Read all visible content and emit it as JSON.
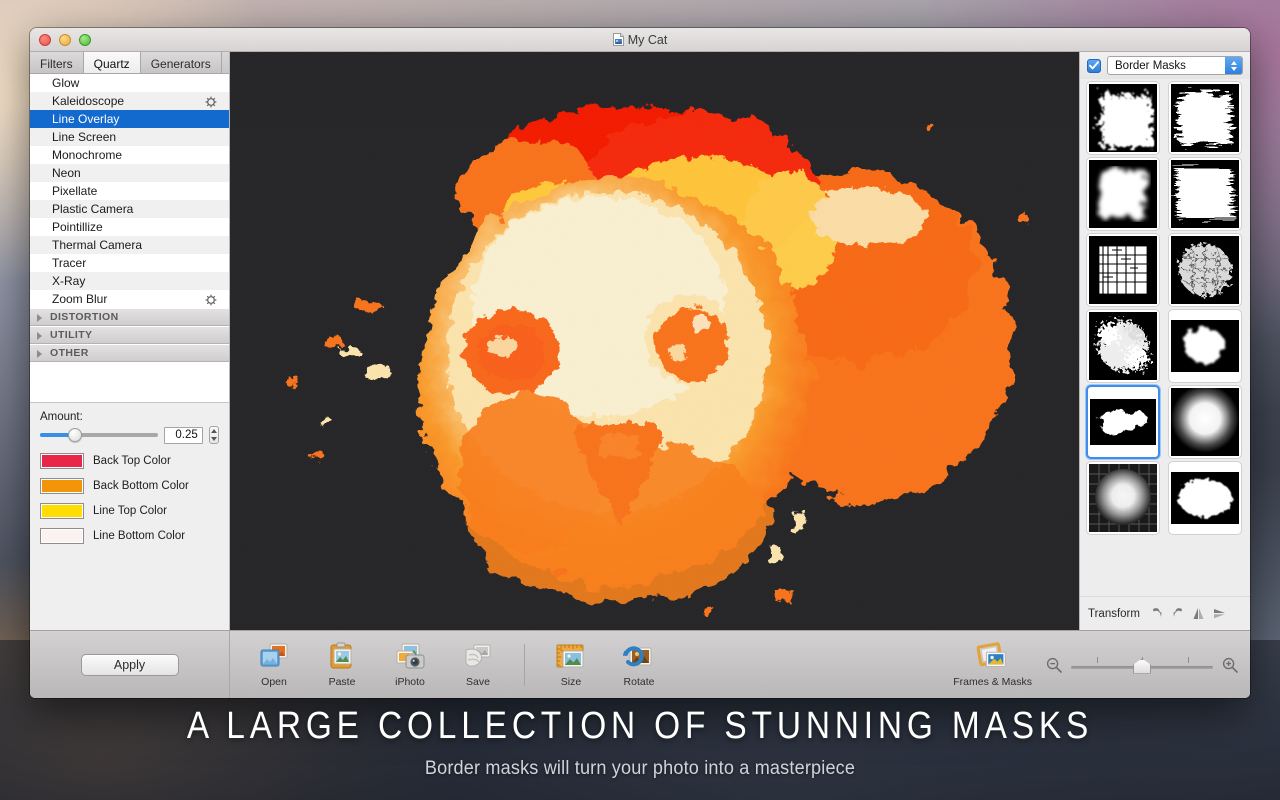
{
  "window": {
    "title": "My Cat",
    "doc_icon": "document-icon",
    "traffic_lights": [
      "close",
      "minimize",
      "zoom"
    ]
  },
  "sidebar": {
    "tabs": [
      {
        "label": "Filters",
        "active": false
      },
      {
        "label": "Quartz",
        "active": true
      },
      {
        "label": "Generators",
        "active": false
      }
    ],
    "filters": [
      {
        "label": "Glow",
        "selected": false,
        "gear": false
      },
      {
        "label": "Kaleidoscope",
        "selected": false,
        "gear": true
      },
      {
        "label": "Line Overlay",
        "selected": true,
        "gear": false
      },
      {
        "label": "Line Screen",
        "selected": false,
        "gear": false
      },
      {
        "label": "Monochrome",
        "selected": false,
        "gear": false
      },
      {
        "label": "Neon",
        "selected": false,
        "gear": false
      },
      {
        "label": "Pixellate",
        "selected": false,
        "gear": false
      },
      {
        "label": "Plastic Camera",
        "selected": false,
        "gear": false
      },
      {
        "label": "Pointillize",
        "selected": false,
        "gear": false
      },
      {
        "label": "Thermal Camera",
        "selected": false,
        "gear": false
      },
      {
        "label": "Tracer",
        "selected": false,
        "gear": false
      },
      {
        "label": "X-Ray",
        "selected": false,
        "gear": false
      },
      {
        "label": "Zoom Blur",
        "selected": false,
        "gear": true
      }
    ],
    "sections": [
      {
        "label": "DISTORTION",
        "expanded": false
      },
      {
        "label": "UTILITY",
        "expanded": false
      },
      {
        "label": "OTHER",
        "expanded": false
      }
    ]
  },
  "params": {
    "amount_label": "Amount:",
    "amount_value": "0.25",
    "slider_percent": 25,
    "colors": [
      {
        "label": "Back Top Color",
        "hex": "#e8264a"
      },
      {
        "label": "Back Bottom Color",
        "hex": "#f39508"
      },
      {
        "label": "Line Top Color",
        "hex": "#ffdd00"
      },
      {
        "label": "Line Bottom Color",
        "hex": "#fdf2f2"
      }
    ]
  },
  "canvas": {
    "background": "#262628",
    "artwork": "posterized-cat-portrait",
    "palette": [
      "#1f1f21",
      "#f21f06",
      "#f8731a",
      "#ffcd3d",
      "#fbe3ad",
      "#f9efd0"
    ]
  },
  "right_panel": {
    "enabled": true,
    "category": "Border Masks",
    "masks": [
      {
        "name": "jagged-brush-square",
        "selected": false
      },
      {
        "name": "scribble-square",
        "selected": false
      },
      {
        "name": "soft-feather-square",
        "selected": false
      },
      {
        "name": "horizontal-streaks",
        "selected": false
      },
      {
        "name": "pebble-mosaic",
        "selected": false
      },
      {
        "name": "rock-rubble",
        "selected": false
      },
      {
        "name": "foliage-splatter",
        "selected": false
      },
      {
        "name": "cloud-blob-oval",
        "selected": false
      },
      {
        "name": "ink-splat-blob",
        "selected": true
      },
      {
        "name": "radial-gradient-oval",
        "selected": false
      },
      {
        "name": "stone-ring-circle",
        "selected": false
      },
      {
        "name": "scalloped-oval",
        "selected": false
      }
    ],
    "transform": {
      "label": "Transform",
      "buttons": [
        {
          "name": "rotate-left-icon"
        },
        {
          "name": "rotate-right-icon"
        },
        {
          "name": "flip-horizontal-icon"
        },
        {
          "name": "flip-vertical-icon"
        }
      ]
    }
  },
  "toolbar": {
    "apply_label": "Apply",
    "tools": [
      {
        "label": "Open",
        "icon": "open-image-icon"
      },
      {
        "label": "Paste",
        "icon": "paste-image-icon"
      },
      {
        "label": "iPhoto",
        "icon": "iphoto-camera-icon"
      },
      {
        "label": "Save",
        "icon": "save-image-icon"
      }
    ],
    "tools2": [
      {
        "label": "Size",
        "icon": "size-ruler-icon"
      },
      {
        "label": "Rotate",
        "icon": "rotate-image-icon"
      }
    ],
    "frames_masks": {
      "label": "Frames & Masks",
      "icon": "frames-masks-icon"
    },
    "zoom": {
      "out_icon": "zoom-out-icon",
      "in_icon": "zoom-in-icon",
      "position_percent": 44
    }
  },
  "caption": {
    "title": "A LARGE COLLECTION OF STUNNING MASKS",
    "subtitle": "Border masks will turn your photo into a masterpiece"
  }
}
